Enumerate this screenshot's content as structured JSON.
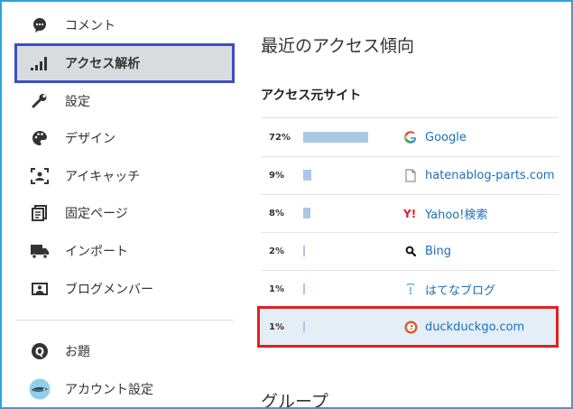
{
  "sidebar": {
    "items": [
      {
        "label": "コメント",
        "icon": "comment-icon"
      },
      {
        "label": "アクセス解析",
        "icon": "signal-bars-icon",
        "active": true
      },
      {
        "label": "設定",
        "icon": "wrench-icon"
      },
      {
        "label": "デザイン",
        "icon": "palette-icon"
      },
      {
        "label": "アイキャッチ",
        "icon": "eyecatch-icon"
      },
      {
        "label": "固定ページ",
        "icon": "pages-icon"
      },
      {
        "label": "インポート",
        "icon": "truck-icon"
      },
      {
        "label": "ブログメンバー",
        "icon": "member-card-icon"
      }
    ],
    "bottom_items": [
      {
        "label": "お題",
        "icon": "odai-icon"
      },
      {
        "label": "アカウント設定",
        "icon": "avatar-icon"
      }
    ]
  },
  "main": {
    "title": "最近のアクセス傾向",
    "subtitle": "アクセス元サイト",
    "rows": [
      {
        "percent": "72%",
        "share": 0.72,
        "site": "Google",
        "icon": "google-icon"
      },
      {
        "percent": "9%",
        "share": 0.09,
        "site": "hatenablog-parts.com",
        "icon": "document-icon"
      },
      {
        "percent": "8%",
        "share": 0.08,
        "site": "Yahoo!検索",
        "icon": "yahoo-icon"
      },
      {
        "percent": "2%",
        "share": 0.02,
        "site": "Bing",
        "icon": "search-icon"
      },
      {
        "percent": "1%",
        "share": 0.01,
        "site": "はてなブログ",
        "icon": "hatena-blog-icon"
      },
      {
        "percent": "1%",
        "share": 0.01,
        "site": "duckduckgo.com",
        "icon": "duckduckgo-icon",
        "highlighted": true
      }
    ],
    "next_section_title": "グループ"
  },
  "colors": {
    "frame_border": "#29a3e0",
    "active_outline": "#3d4fc4",
    "highlight_outline": "#e02020",
    "bar_fill": "#a9c8e6",
    "link": "#1e6fb8"
  }
}
